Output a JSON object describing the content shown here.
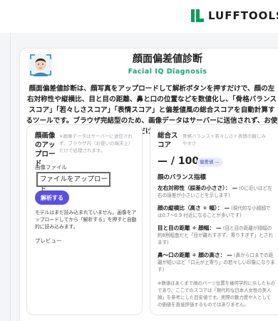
{
  "brand": {
    "name": "LUFFTOOLS",
    "icon": "lufftools-logo",
    "color": "#0f9d58"
  },
  "header": {
    "title": "顔面偏差値診断",
    "subtitle": "Facial IQ Diagnosis",
    "avatar_icon": "face-scan-icon"
  },
  "description": "顔面偏差値診断は、顔写真をアップロードして解析ボタンを押すだけで、顔の左右対称性や縦横比、目と目の距離、鼻と口の位置などを数値化し、「骨格バランススコア」「若々しさスコア」「表情スコア」と偏差値風の総合スコアを自動計算するツールです。ブラウザ完結型のため、画像データはサーバーに送信されず、お使いの端末の中だけで処理されます。",
  "upload_panel": {
    "title": "顔画像のアップロード",
    "note": "※画像データはサーバーに送信されず、ブラウザ内（お使いの端末上）だけで処理されます。",
    "file_label": "画像ファイル",
    "file_button": "ファイルをアップロード",
    "analyze_button": "解析する",
    "model_note": "モデルはまだ読み込まれていません。画像をアップロードしてから「解析する」を押すと自動的に読み込みます。",
    "preview_label": "プレビュー"
  },
  "score_panel": {
    "title": "総合スコア",
    "note": "骨格バランス＋若々しさ＋表情の観しみやすさ",
    "score": "— / 100",
    "badge": "偏差値 —",
    "balance_heading": "顔のバランス指標",
    "metrics": [
      {
        "label": "左右対称性（誤差の小ささ）：",
        "value": "—",
        "note": "(0に近いほど左右の誤差が小さいことを示します)"
      },
      {
        "label": "顔の縦横比（高さ ÷ 幅）：",
        "value": "—",
        "note": "(現代的な小顔顔では0.7〜0.9 付近になることが多いです)"
      },
      {
        "label": "目と目の距離 ÷ 顔幅：",
        "value": "—",
        "note": "(目と目の距離が顔幅の約8割程度だと「目が離れすぎず、寄りすぎず」とされます)"
      },
      {
        "label": "鼻〜口の距離 ÷ 顔の高さ：",
        "value": "—",
        "note": "(鼻から口までの距離が短いほど「口元が上寄り」の若々しい印象になります)"
      }
    ],
    "disclaimer": "※数値はあくまで顔のパーツ位置を幾何学的に示したものであり、ここでのスコアは「現代的な日本人女性の美人顔」を参考にした目安値です。実際の魅力度や人としての価値を直接評価するものではありません。"
  }
}
